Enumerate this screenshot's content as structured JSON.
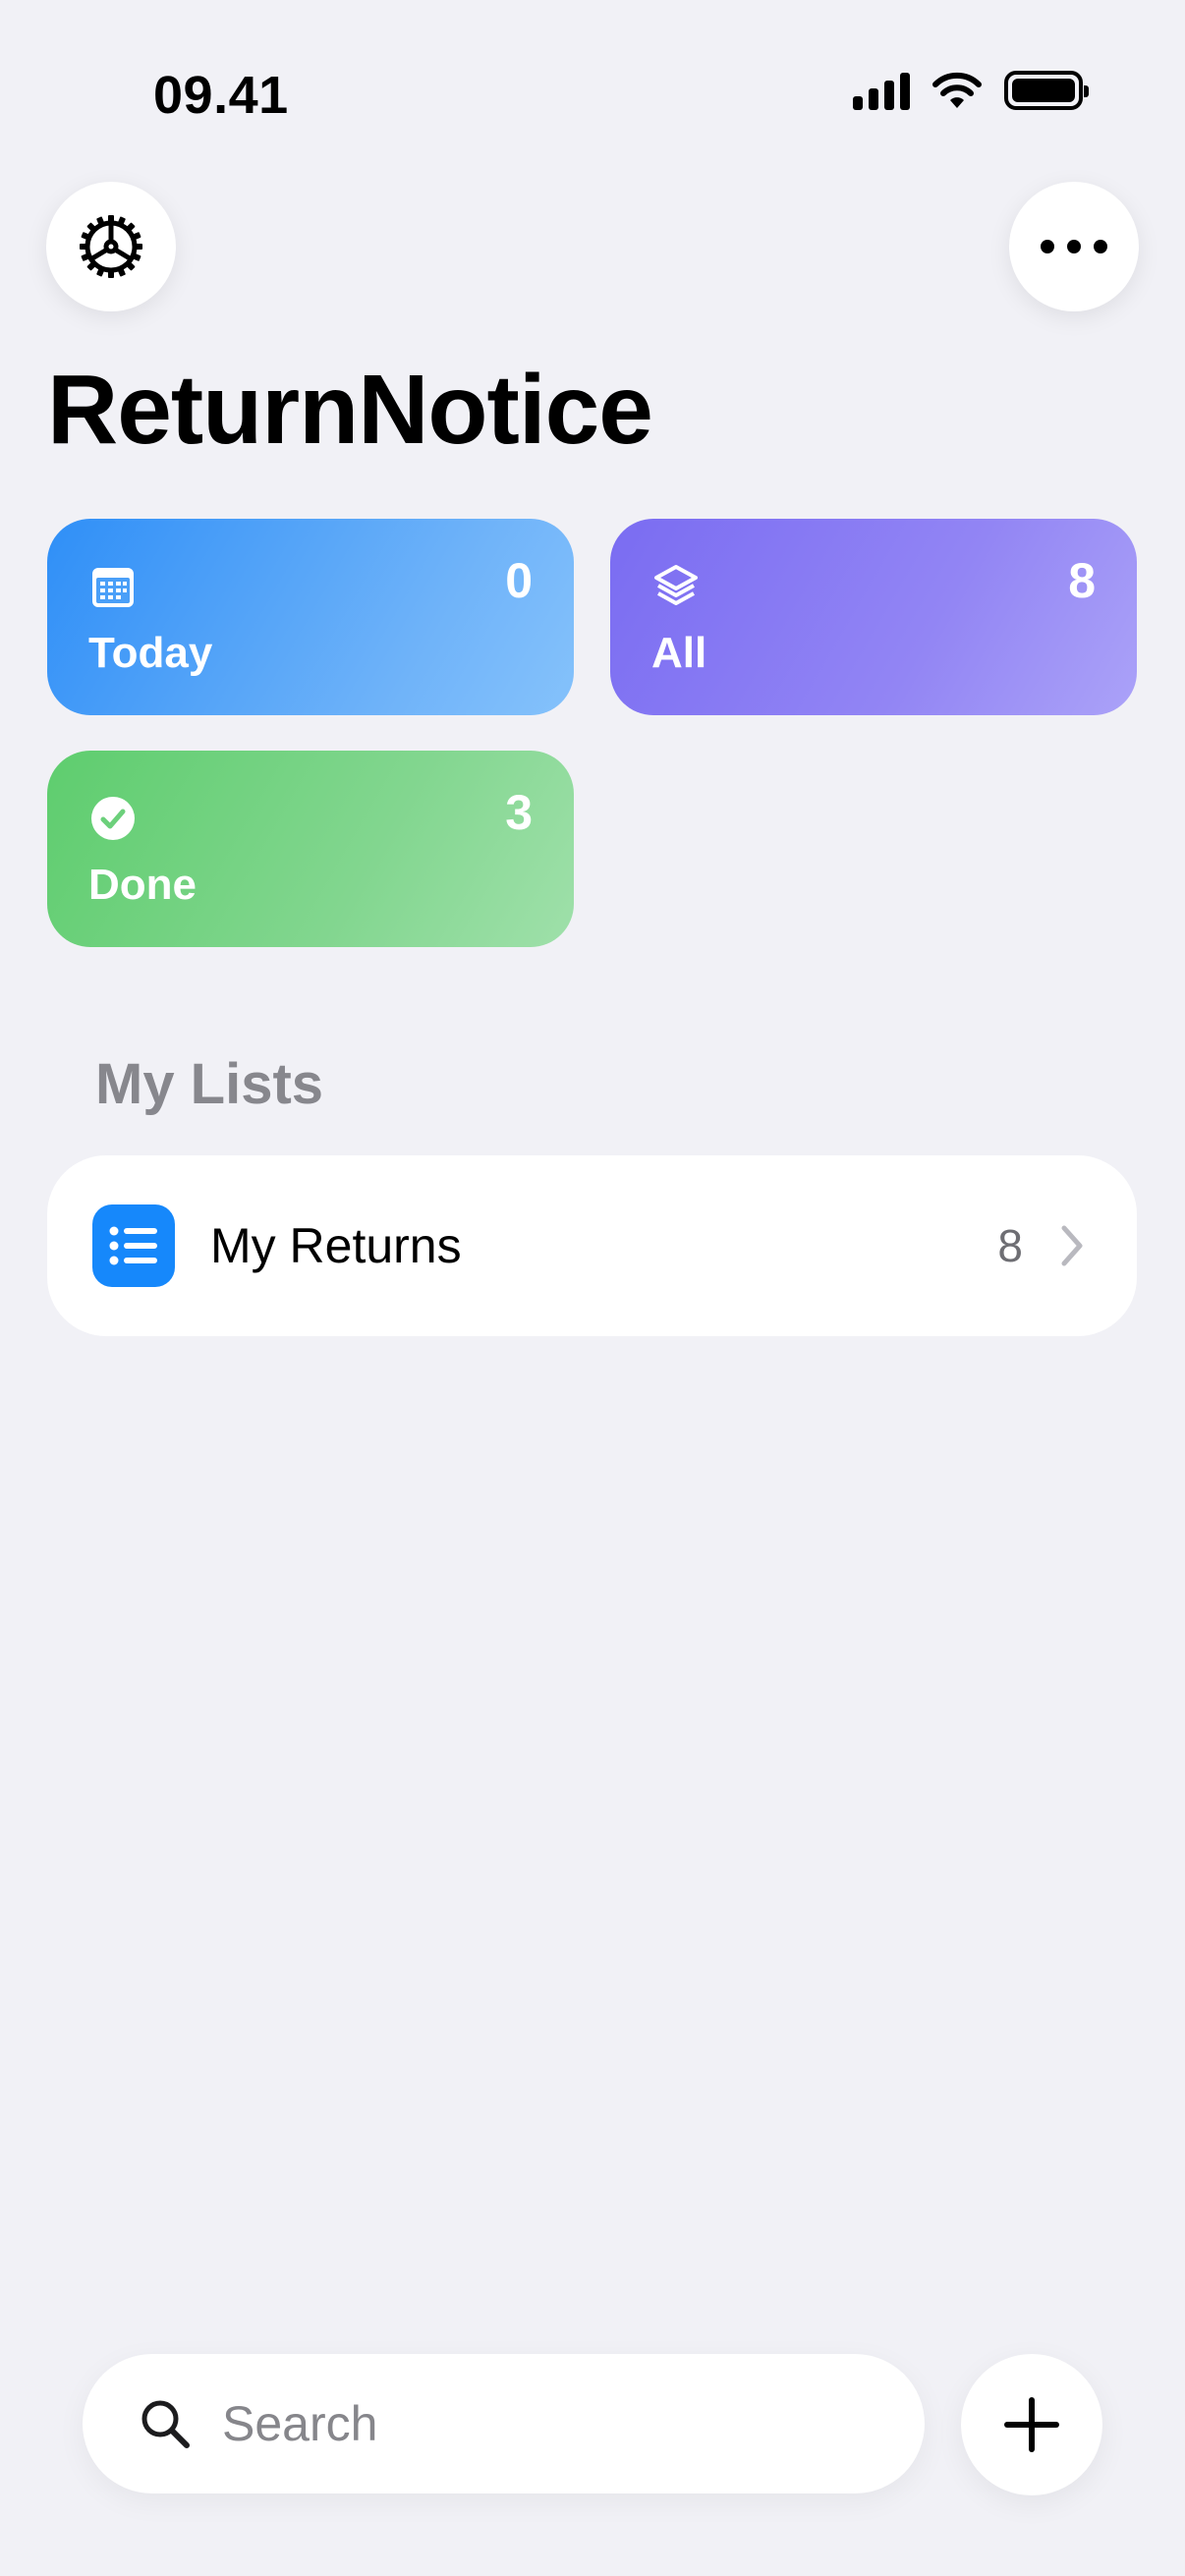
{
  "status_bar": {
    "time": "09.41",
    "signal_icon": "cellular-signal-icon",
    "wifi_icon": "wifi-icon",
    "battery_icon": "battery-icon"
  },
  "header": {
    "settings_icon": "gear-icon",
    "more_icon": "ellipsis-icon",
    "title": "ReturnNotice"
  },
  "smart_lists": [
    {
      "label": "Today",
      "count": "0",
      "icon": "calendar-icon",
      "color": "#2f8ff7"
    },
    {
      "label": "All",
      "count": "8",
      "icon": "stack-icon",
      "color": "#7a6cf2"
    },
    {
      "label": "Done",
      "count": "3",
      "icon": "checkmark-circle-icon",
      "color": "#5ecd6e"
    }
  ],
  "my_lists": {
    "section_title": "My Lists",
    "items": [
      {
        "name": "My Returns",
        "count": "8",
        "icon": "list-bullet-icon",
        "color": "#1688fb"
      }
    ]
  },
  "bottom_bar": {
    "search_placeholder": "Search",
    "search_icon": "magnifying-glass-icon",
    "add_icon": "plus-icon"
  }
}
